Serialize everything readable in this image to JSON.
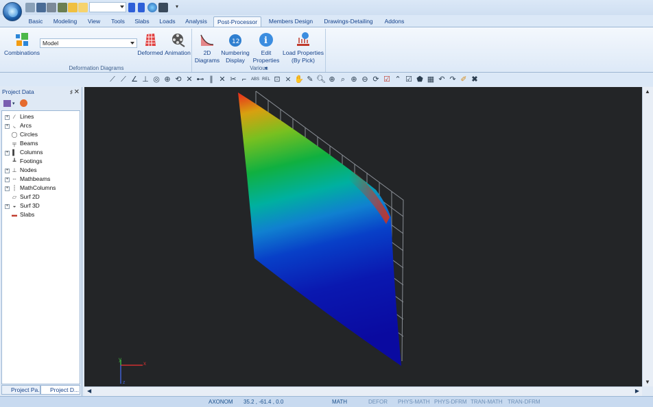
{
  "quick_access": {
    "items": [
      "open-icon",
      "save-icon",
      "print-icon",
      "preview-icon",
      "view-icon",
      "undo-icon"
    ],
    "combo_value": "",
    "more": "▾"
  },
  "tabs": [
    {
      "label": "Basic"
    },
    {
      "label": "Modeling"
    },
    {
      "label": "View"
    },
    {
      "label": "Tools"
    },
    {
      "label": "Slabs"
    },
    {
      "label": "Loads"
    },
    {
      "label": "Analysis"
    },
    {
      "label": "Post-Processor",
      "active": true
    },
    {
      "label": "Members Design"
    },
    {
      "label": "Drawings-Detailing"
    },
    {
      "label": "Addons"
    }
  ],
  "ribbon": {
    "deformation": {
      "combinations": "Combinations",
      "model_value": "Model",
      "deformed": "Deformed",
      "animation": "Animation",
      "group_label": "Deformation Diagrams"
    },
    "various": {
      "diagrams_2d_l1": "2D",
      "diagrams_2d_l2": "Diagrams",
      "numbering_l1": "Numbering",
      "numbering_l2": "Display",
      "edit_l1": "Edit",
      "edit_l2": "Properties",
      "load_l1": "Load Properties",
      "load_l2": "(By Pick)",
      "group_label": "Various"
    }
  },
  "panel": {
    "title": "Project Data",
    "pin": "♯",
    "close": "✕",
    "tree": [
      {
        "label": "Lines",
        "expandable": true,
        "icon": "∕"
      },
      {
        "label": "Arcs",
        "expandable": true,
        "icon": "◟"
      },
      {
        "label": "Circles",
        "expandable": false,
        "icon": "◯"
      },
      {
        "label": "Beams",
        "expandable": false,
        "icon": "╤"
      },
      {
        "label": "Columns",
        "expandable": true,
        "icon": "▌"
      },
      {
        "label": "Footings",
        "expandable": false,
        "icon": "┻"
      },
      {
        "label": "Nodes",
        "expandable": true,
        "icon": "⊥"
      },
      {
        "label": "Mathbeams",
        "expandable": true,
        "icon": "┄"
      },
      {
        "label": "MathColumns",
        "expandable": true,
        "icon": "┆"
      },
      {
        "label": "Surf 2D",
        "expandable": false,
        "icon": "▱"
      },
      {
        "label": "Surf 3D",
        "expandable": true,
        "icon": "◒"
      },
      {
        "label": "Slabs",
        "expandable": false,
        "icon": "▬"
      }
    ],
    "bottom_tabs": [
      "Project Pa...",
      "Project D..."
    ]
  },
  "viewport": {
    "axis_x": "x",
    "axis_y": "y",
    "axis_z": "z"
  },
  "status": {
    "view": "AXONOM",
    "coords": "35.2 , -61.4 , 0.0",
    "math": "MATH",
    "defor": "DEFOR",
    "phys_math": "PHYS-MATH",
    "phys_dfrm": "PHYS-DFRM",
    "tran_math": "TRAN-MATH",
    "tran_dfrm": "TRAN-DFRM"
  },
  "colors": {
    "viewport_bg": "#232527",
    "ribbon_text": "#15428b",
    "accent_red": "#d0201a",
    "accent_blue": "#0a16a0"
  }
}
